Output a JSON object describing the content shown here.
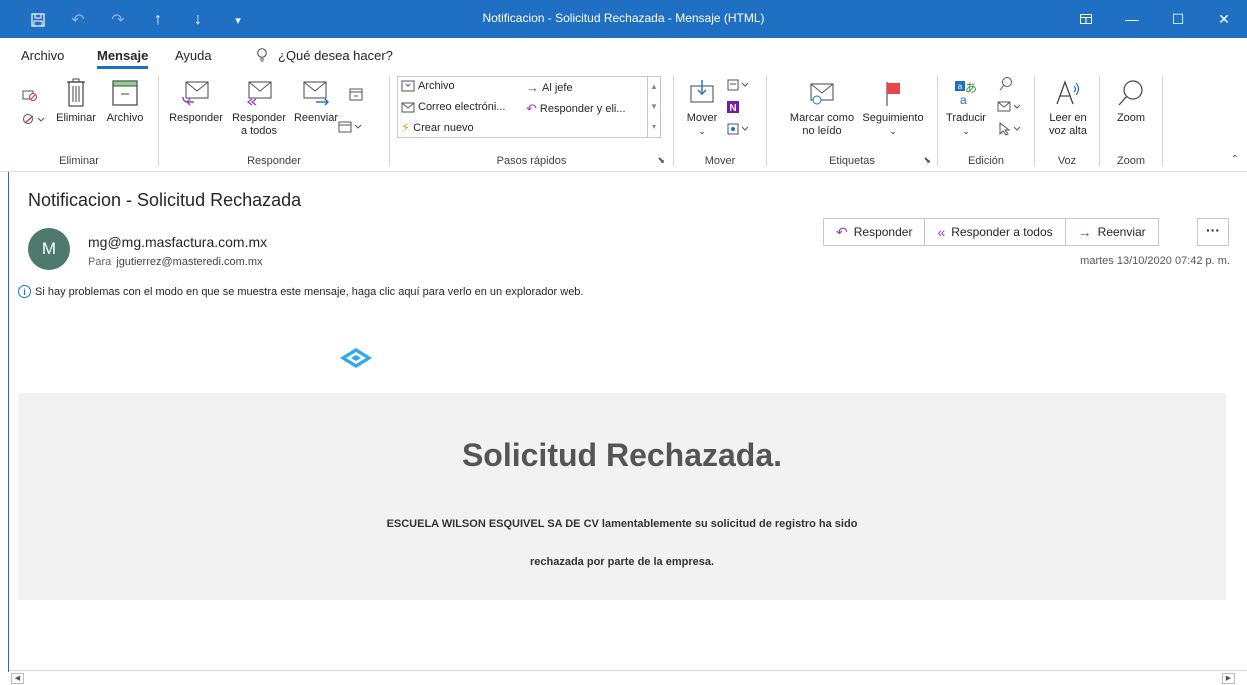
{
  "window": {
    "title": "Notificacion - Solicitud Rechazada  -  Mensaje (HTML)"
  },
  "tabs": [
    {
      "label": "Archivo"
    },
    {
      "label": "Mensaje"
    },
    {
      "label": "Ayuda"
    },
    {
      "label": "¿Qué desea hacer?"
    }
  ],
  "ribbon": {
    "eliminar": {
      "group_label": "Eliminar",
      "delete_label": "Eliminar",
      "archive_label": "Archivo"
    },
    "responder": {
      "group_label": "Responder",
      "reply_label": "Responder",
      "reply_all_label_1": "Responder",
      "reply_all_label_2": "a todos",
      "forward_label": "Reenviar"
    },
    "pasos_rapidos": {
      "group_label": "Pasos rápidos",
      "items": [
        "Archivo",
        "Al jefe",
        "Correo electróni...",
        "Responder y eli...",
        "Crear nuevo"
      ]
    },
    "mover": {
      "group_label": "Mover",
      "move_label": "Mover"
    },
    "etiquetas": {
      "group_label": "Etiquetas",
      "unread_label_1": "Marcar como",
      "unread_label_2": "no leído",
      "followup_label": "Seguimiento"
    },
    "edicion": {
      "group_label": "Edición",
      "translate_label": "Traducir"
    },
    "voz": {
      "group_label": "Voz",
      "read_label_1": "Leer en",
      "read_label_2": "voz alta"
    },
    "zoom": {
      "group_label": "Zoom",
      "zoom_label": "Zoom"
    }
  },
  "message": {
    "subject": "Notificacion - Solicitud Rechazada",
    "avatar_initial": "M",
    "sender": "mg@mg.masfactura.com.mx",
    "to_label": "Para",
    "to": "jgutierrez@masteredi.com.mx",
    "info": "Si hay problemas con el modo en que se muestra este mensaje, haga clic aquí para verlo en un explorador web.",
    "date": "martes 13/10/2020 07:42 p. m.",
    "actions": {
      "reply": "Responder",
      "reply_all": "Responder a todos",
      "forward": "Reenviar",
      "more": "···"
    }
  },
  "body": {
    "title": "Solicitud Rechazada.",
    "line1": "ESCUELA WILSON ESQUIVEL SA DE CV lamentablemente su solicitud de registro ha sido",
    "line2": "rechazada por parte de la empresa."
  },
  "colors": {
    "titlebar": "#1f6fc3",
    "avatar": "#4e7a6d",
    "logo": "#2ea8e6"
  }
}
